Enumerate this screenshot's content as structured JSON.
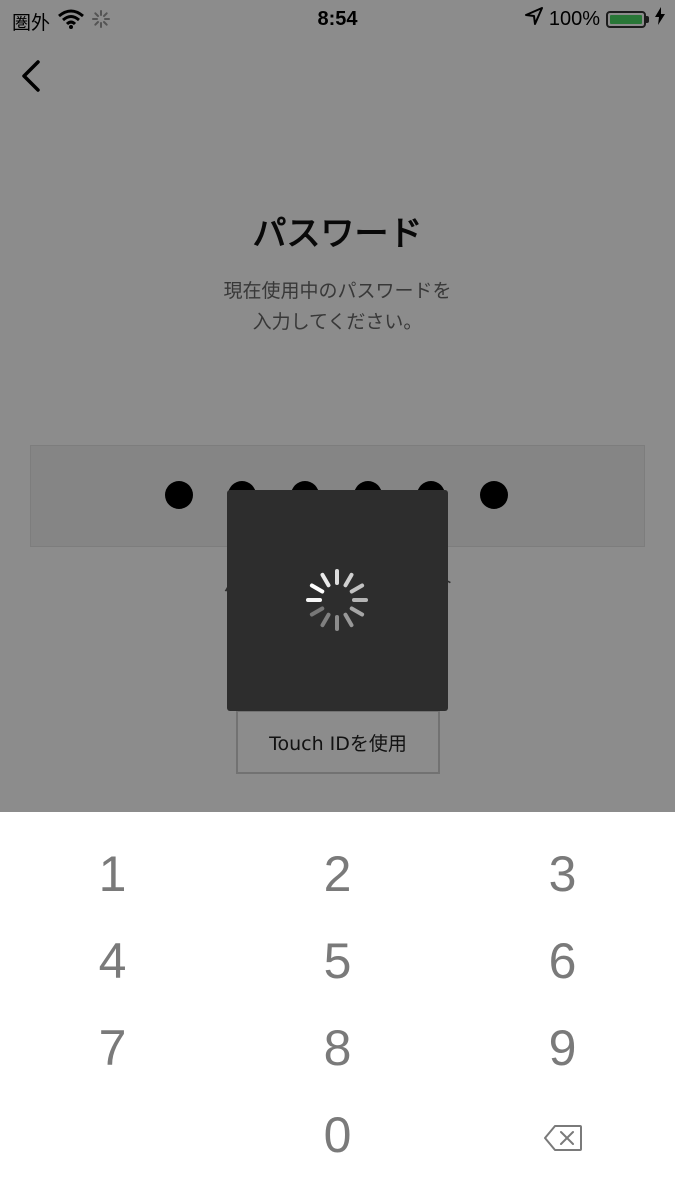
{
  "status_bar": {
    "carrier": "圏外",
    "time": "8:54",
    "battery_percent": "100%",
    "icons": [
      "wifi-icon",
      "activity-spinner-icon",
      "location-arrow-icon",
      "battery-icon",
      "charging-bolt-icon"
    ]
  },
  "header": {
    "back_icon": "chevron-left-icon"
  },
  "page": {
    "title": "パスワード",
    "subtitle_line1": "現在使用中のパスワードを",
    "subtitle_line2": "入力してください。"
  },
  "password": {
    "entered_digits": 6,
    "total_digits": 6
  },
  "forgot_link": "パスワードをお忘れの場合",
  "touch_id_button": "Touch IDを使用",
  "loading_overlay": {
    "visible": true,
    "icon": "loading-spinner-icon"
  },
  "keypad": {
    "keys": [
      "1",
      "2",
      "3",
      "4",
      "5",
      "6",
      "7",
      "8",
      "9",
      "",
      "0",
      ""
    ],
    "delete_icon": "backspace-icon"
  },
  "colors": {
    "overlay": "#000000",
    "hud_background": "#2d2d2d",
    "battery_green": "#4cd964",
    "key_text": "#7a7a7a"
  }
}
